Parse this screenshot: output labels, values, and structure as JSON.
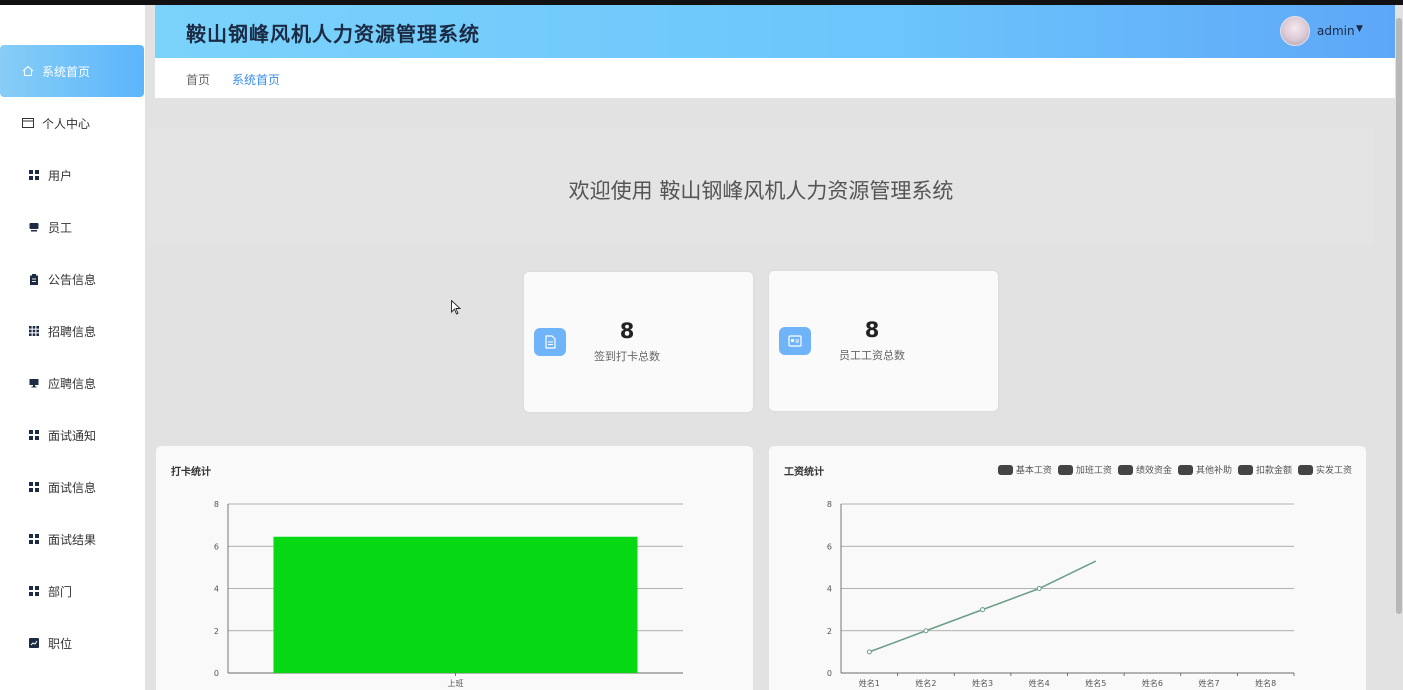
{
  "app": {
    "title": "鞍山钢峰风机人力资源管理系统",
    "user": "admin",
    "caret": "▼"
  },
  "sidebar": {
    "items": [
      {
        "label": "系统首页",
        "icon": "home-icon",
        "active": true
      },
      {
        "label": "个人中心",
        "icon": "card-icon"
      },
      {
        "label": "用户",
        "icon": "grid-icon"
      },
      {
        "label": "员工",
        "icon": "monitor-icon"
      },
      {
        "label": "公告信息",
        "icon": "clipboard-icon"
      },
      {
        "label": "招聘信息",
        "icon": "grid9-icon"
      },
      {
        "label": "应聘信息",
        "icon": "monitor-icon"
      },
      {
        "label": "面试通知",
        "icon": "grid-icon"
      },
      {
        "label": "面试信息",
        "icon": "grid-icon"
      },
      {
        "label": "面试结果",
        "icon": "grid-icon"
      },
      {
        "label": "部门",
        "icon": "grid-icon"
      },
      {
        "label": "职位",
        "icon": "chart-icon"
      }
    ]
  },
  "breadcrumb": {
    "home": "首页",
    "current": "系统首页"
  },
  "welcome": {
    "text": "欢迎使用 鞍山钢峰风机人力资源管理系统"
  },
  "stats": [
    {
      "value": "8",
      "label": "签到打卡总数",
      "icon": "document-icon"
    },
    {
      "value": "8",
      "label": "员工工资总数",
      "icon": "id-card-icon"
    }
  ],
  "colors": {
    "accent": "#5bb6fb",
    "bar": "#07d814",
    "line": "#6a9e86",
    "legend_swatch": "#444444"
  },
  "chart_data": [
    {
      "type": "bar",
      "title": "打卡统计",
      "categories": [
        "上班"
      ],
      "values": [
        6.45
      ],
      "ylim": [
        0,
        8
      ],
      "yticks": [
        0,
        2,
        4,
        6,
        8
      ],
      "grid": true
    },
    {
      "type": "line",
      "title": "工资统计",
      "legend": [
        "基本工资",
        "加班工资",
        "绩效资金",
        "其他补助",
        "扣款金额",
        "实发工资"
      ],
      "legend_position": "top-right",
      "categories": [
        "姓名1",
        "姓名2",
        "姓名3",
        "姓名4",
        "姓名5",
        "姓名6",
        "姓名7",
        "姓名8"
      ],
      "values": [
        1,
        2,
        3,
        4,
        5.3
      ],
      "ylim": [
        0,
        8
      ],
      "yticks": [
        0,
        2,
        4,
        6,
        8
      ],
      "grid": true
    }
  ]
}
